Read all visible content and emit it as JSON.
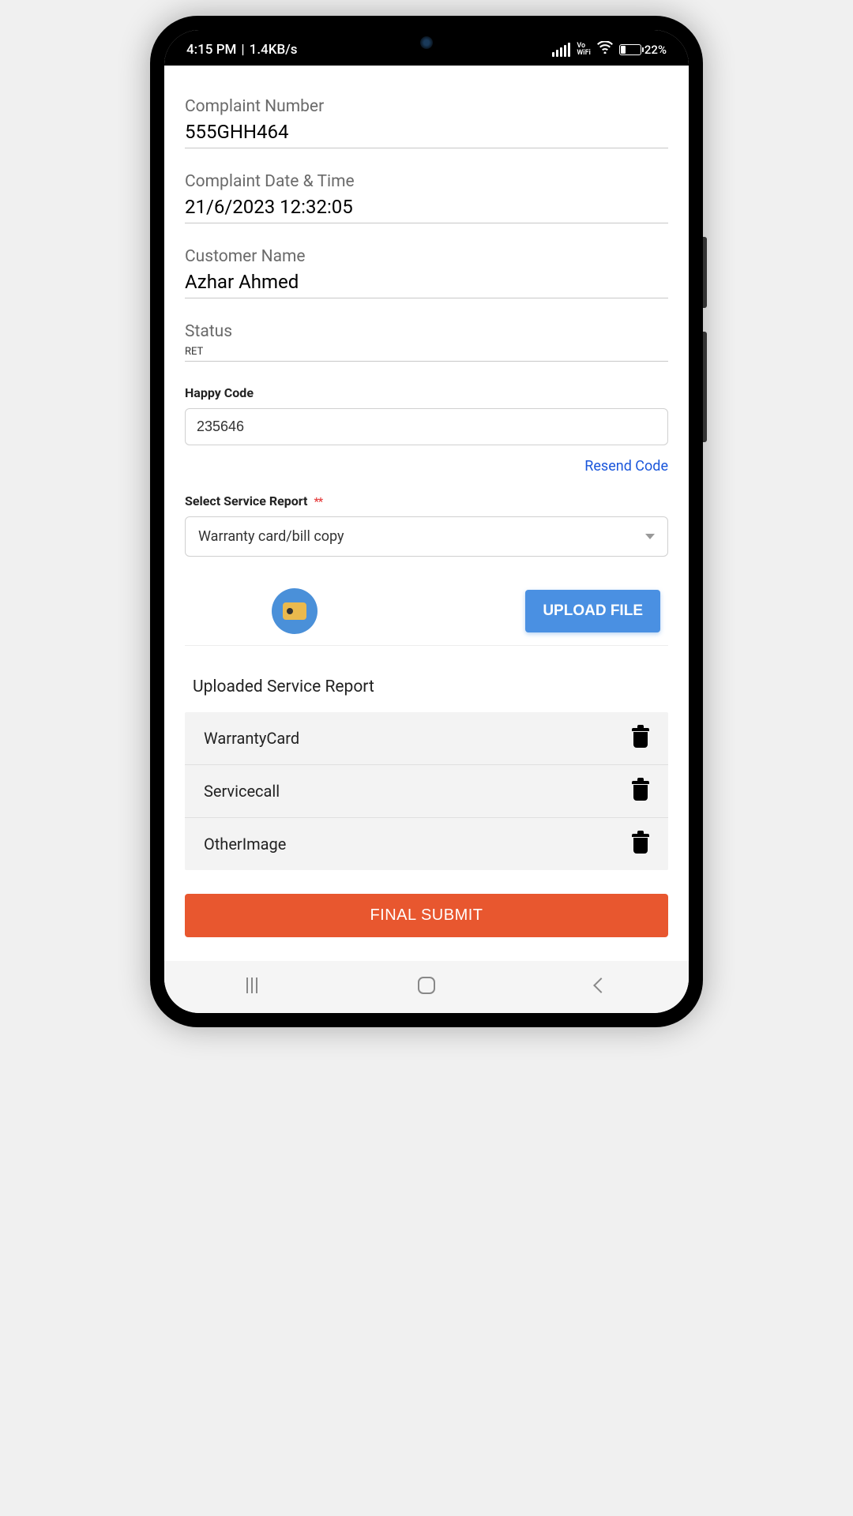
{
  "status_bar": {
    "time": "4:15 PM",
    "speed": "1.4KB/s",
    "vo_wifi": "Vo\nWiFi",
    "battery": "22%"
  },
  "form": {
    "complaint_number_label": "Complaint Number",
    "complaint_number_value": "555GHH464",
    "complaint_datetime_label": "Complaint Date & Time",
    "complaint_datetime_value": "21/6/2023  12:32:05",
    "customer_name_label": "Customer Name",
    "customer_name_value": "Azhar Ahmed",
    "status_label": "Status",
    "status_value": "RET",
    "happy_code_label": "Happy Code",
    "happy_code_value": "235646",
    "resend_code": "Resend Code",
    "select_report_label": "Select Service Report",
    "required_marker": "**",
    "dropdown_selected": "Warranty card/bill copy",
    "upload_button": "UPLOAD FILE",
    "uploaded_header": "Uploaded Service Report",
    "uploaded_items": {
      "0": {
        "name": "WarrantyCard"
      },
      "1": {
        "name": "Servicecall"
      },
      "2": {
        "name": "OtherImage"
      }
    },
    "final_submit": "FINAL SUBMIT"
  }
}
